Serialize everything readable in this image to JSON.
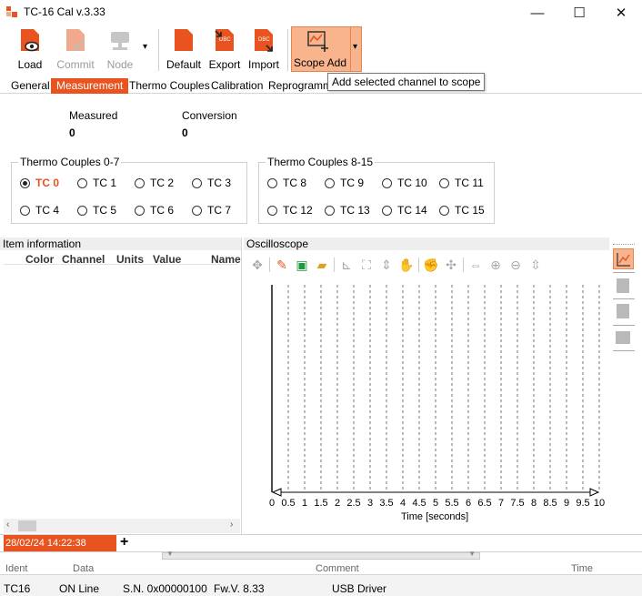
{
  "window": {
    "title": "TC-16 Cal v.3.33",
    "minimize": "—",
    "maximize": "☐",
    "close": "✕"
  },
  "toolbar": {
    "load": "Load",
    "commit": "Commit",
    "node": "Node",
    "node_arrow": "▾",
    "default": "Default",
    "export": "Export",
    "import": "Import",
    "scope_add": "Scope Add",
    "scope_arrow": "▾",
    "tooltip": "Add selected channel to scope"
  },
  "tabs": [
    "General",
    "Measurement",
    "Thermo Couples",
    "Calibration",
    "Reprogrammi"
  ],
  "measurement": {
    "measured_label": "Measured",
    "measured_value": "0",
    "conversion_label": "Conversion",
    "conversion_value": "0"
  },
  "group_a": {
    "title": "Thermo Couples 0-7",
    "selected": "TC 0",
    "items": [
      "TC 0",
      "TC 1",
      "TC 2",
      "TC 3",
      "TC 4",
      "TC 5",
      "TC 6",
      "TC 7"
    ]
  },
  "group_b": {
    "title": "Thermo Couples 8-15",
    "items": [
      "TC 8",
      "TC 9",
      "TC 10",
      "TC 11",
      "TC 12",
      "TC 13",
      "TC 14",
      "TC 15"
    ]
  },
  "item_info": {
    "title": "Item information",
    "columns": [
      "Color",
      "Channel",
      "Units",
      "Value",
      "Name"
    ]
  },
  "oscilloscope": {
    "title": "Oscilloscope",
    "x_ticks": [
      "0",
      "0.5",
      "1",
      "1.5",
      "2",
      "2.5",
      "3",
      "3.5",
      "4",
      "4.5",
      "5",
      "5.5",
      "6",
      "6.5",
      "7",
      "7.5",
      "8",
      "8.5",
      "9",
      "9.5",
      "10"
    ],
    "xlabel": "Time [seconds]"
  },
  "log": {
    "timestamp": "28/02/24 14:22:38",
    "add": "+",
    "columns": [
      "Ident",
      "Data",
      "Comment",
      "Time"
    ]
  },
  "statusbar": {
    "device": "TC16",
    "state": "ON Line",
    "serial": "S.N. 0x00000100",
    "firmware": "Fw.V. 8.33",
    "driver": "USB Driver"
  },
  "colors": {
    "accent": "#e8531f",
    "scope_button": "#f7b48d"
  }
}
